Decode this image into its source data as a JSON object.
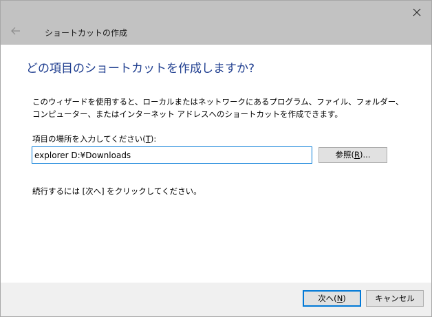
{
  "wizard": {
    "title": "ショートカットの作成",
    "heading": "どの項目のショートカットを作成しますか?",
    "description": "このウィザードを使用すると、ローカルまたはネットワークにあるプログラム、ファイル、フォルダー、コンピューター、またはインターネット アドレスへのショートカットを作成できます。",
    "location_label_prefix": "項目の場所を入力してください(",
    "location_label_key": "T",
    "location_label_suffix": "):",
    "location_value": "explorer D:¥Downloads",
    "browse_prefix": "参照(",
    "browse_key": "R",
    "browse_suffix": ")...",
    "hint": "続行するには [次へ] をクリックしてください。"
  },
  "footer": {
    "next_prefix": "次へ(",
    "next_key": "N",
    "next_suffix": ")",
    "cancel_label": "キャンセル"
  },
  "icons": {
    "close": "close-icon",
    "back": "back-arrow-icon"
  },
  "colors": {
    "heading": "#1e3d8f",
    "accent": "#0078d7",
    "titlebar": "#c2c2c2",
    "footer": "#f0f0f0"
  }
}
